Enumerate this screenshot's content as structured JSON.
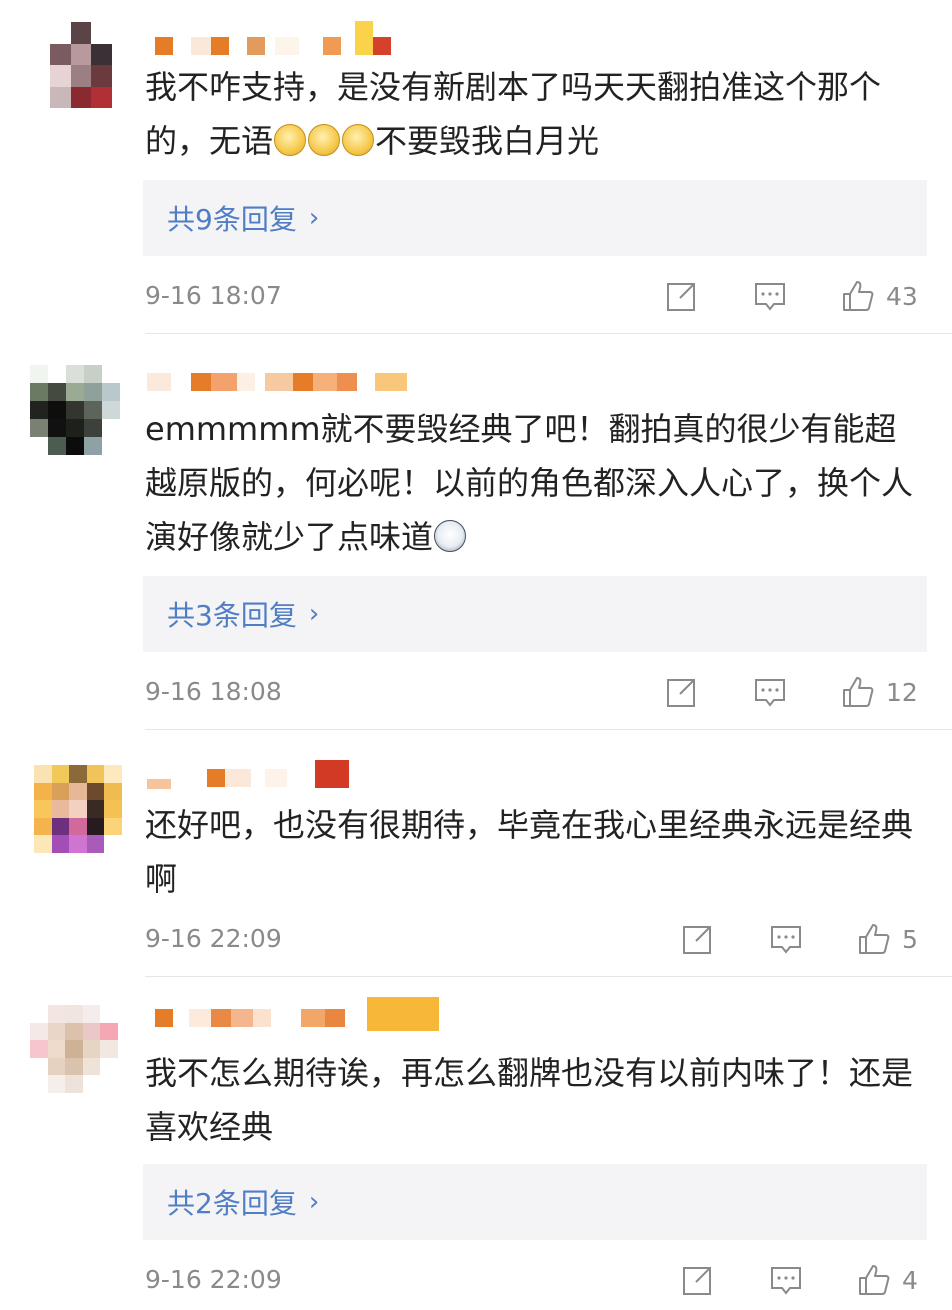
{
  "comments": [
    {
      "text_html": "我不咋支持，是没有新剧本了吗天天翻拍准这个那个的，无语",
      "text_tail": "不要毁我白月光",
      "emoji_count": 3,
      "replies_label": "共9条回复",
      "time": "9-16 18:07",
      "likes": "43"
    },
    {
      "text_html": "emmmmm就不要毁经典了吧！翻拍真的很少有能超越原版的，何必呢！以前的角色都深入人心了，换个人演好像就少了点味道",
      "replies_label": "共3条回复",
      "time": "9-16 18:08",
      "likes": "12"
    },
    {
      "text_html": "还好吧，也没有很期待，毕竟在我心里经典永远是经典啊",
      "time": "9-16 22:09",
      "likes": "5"
    },
    {
      "text_html": "我不怎么期待诶，再怎么翻牌也没有以前内味了！还是喜欢经典",
      "replies_label": "共2条回复",
      "time": "9-16 22:09",
      "likes": "4"
    }
  ],
  "icons": {
    "share": "share-icon",
    "comment": "comment-icon",
    "like": "thumbs-up-icon"
  },
  "colors": {
    "link": "#4f7ec4",
    "meta": "#8a8a8a",
    "reply_bg": "#f4f4f6"
  }
}
